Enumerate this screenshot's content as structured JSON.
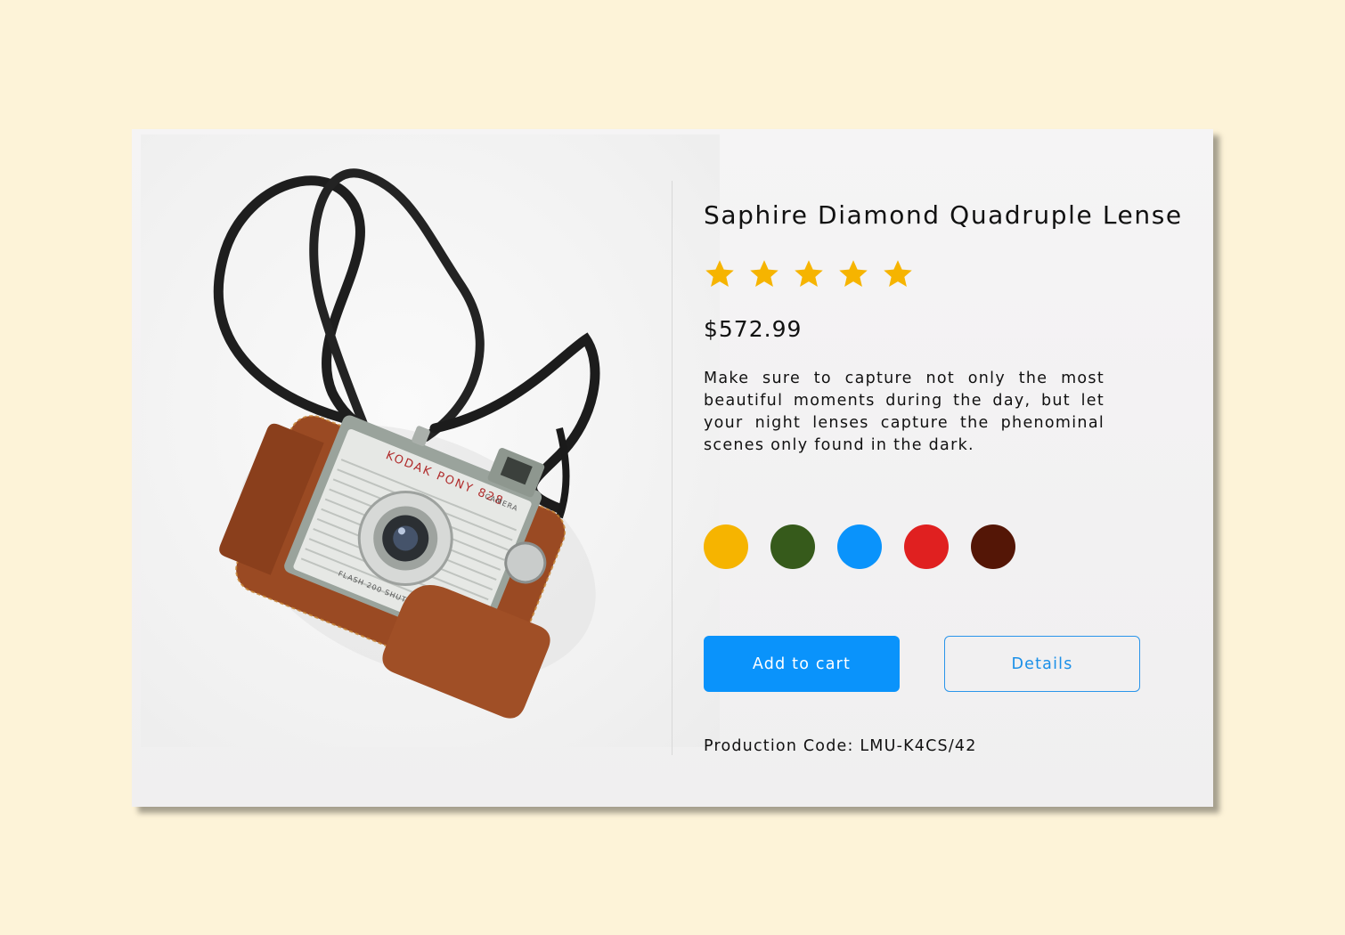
{
  "product": {
    "title": "Saphire Diamond Quadruple Lense",
    "rating": 5,
    "rating_max": 5,
    "star_color": "#f6b400",
    "price": "$572.99",
    "description": "Make sure to capture not only the most beautiful moments during the day, but let your night lenses capture the phenominal scenes only found in the dark.",
    "colors": [
      "#f6b400",
      "#365a1b",
      "#0a93fb",
      "#e02020",
      "#541606"
    ],
    "production_code": "Production Code: LMU-K4CS/42"
  },
  "photo": {
    "camera_front_label": "KODAK PONY 828",
    "camera_side_label": "CAMERA",
    "shutter_label": "FLASH 200 SHUTTER"
  },
  "actions": {
    "add_to_cart_label": "Add to cart",
    "details_label": "Details",
    "primary_color": "#0a93fb"
  }
}
